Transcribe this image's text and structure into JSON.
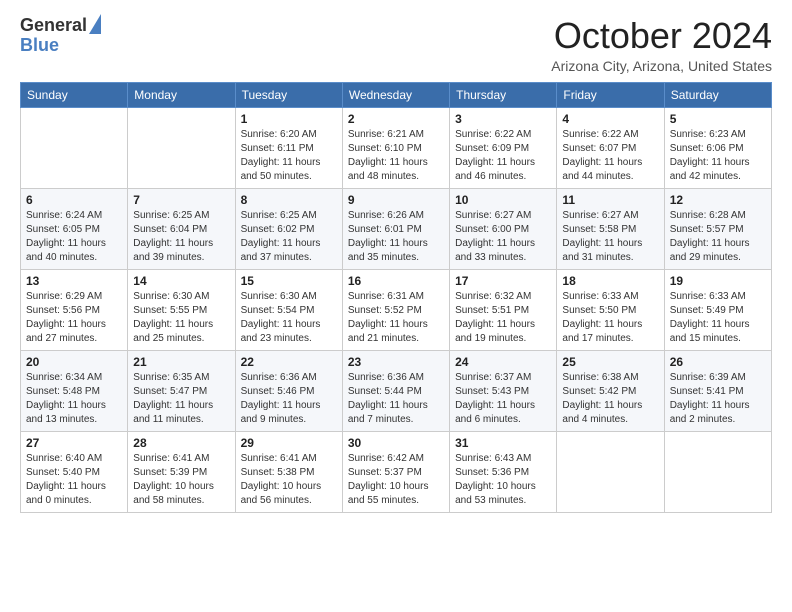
{
  "logo": {
    "line1": "General",
    "line2": "Blue"
  },
  "header": {
    "month": "October 2024",
    "location": "Arizona City, Arizona, United States"
  },
  "days_of_week": [
    "Sunday",
    "Monday",
    "Tuesday",
    "Wednesday",
    "Thursday",
    "Friday",
    "Saturday"
  ],
  "weeks": [
    [
      {
        "day": "",
        "info": ""
      },
      {
        "day": "",
        "info": ""
      },
      {
        "day": "1",
        "info": "Sunrise: 6:20 AM\nSunset: 6:11 PM\nDaylight: 11 hours and 50 minutes."
      },
      {
        "day": "2",
        "info": "Sunrise: 6:21 AM\nSunset: 6:10 PM\nDaylight: 11 hours and 48 minutes."
      },
      {
        "day": "3",
        "info": "Sunrise: 6:22 AM\nSunset: 6:09 PM\nDaylight: 11 hours and 46 minutes."
      },
      {
        "day": "4",
        "info": "Sunrise: 6:22 AM\nSunset: 6:07 PM\nDaylight: 11 hours and 44 minutes."
      },
      {
        "day": "5",
        "info": "Sunrise: 6:23 AM\nSunset: 6:06 PM\nDaylight: 11 hours and 42 minutes."
      }
    ],
    [
      {
        "day": "6",
        "info": "Sunrise: 6:24 AM\nSunset: 6:05 PM\nDaylight: 11 hours and 40 minutes."
      },
      {
        "day": "7",
        "info": "Sunrise: 6:25 AM\nSunset: 6:04 PM\nDaylight: 11 hours and 39 minutes."
      },
      {
        "day": "8",
        "info": "Sunrise: 6:25 AM\nSunset: 6:02 PM\nDaylight: 11 hours and 37 minutes."
      },
      {
        "day": "9",
        "info": "Sunrise: 6:26 AM\nSunset: 6:01 PM\nDaylight: 11 hours and 35 minutes."
      },
      {
        "day": "10",
        "info": "Sunrise: 6:27 AM\nSunset: 6:00 PM\nDaylight: 11 hours and 33 minutes."
      },
      {
        "day": "11",
        "info": "Sunrise: 6:27 AM\nSunset: 5:58 PM\nDaylight: 11 hours and 31 minutes."
      },
      {
        "day": "12",
        "info": "Sunrise: 6:28 AM\nSunset: 5:57 PM\nDaylight: 11 hours and 29 minutes."
      }
    ],
    [
      {
        "day": "13",
        "info": "Sunrise: 6:29 AM\nSunset: 5:56 PM\nDaylight: 11 hours and 27 minutes."
      },
      {
        "day": "14",
        "info": "Sunrise: 6:30 AM\nSunset: 5:55 PM\nDaylight: 11 hours and 25 minutes."
      },
      {
        "day": "15",
        "info": "Sunrise: 6:30 AM\nSunset: 5:54 PM\nDaylight: 11 hours and 23 minutes."
      },
      {
        "day": "16",
        "info": "Sunrise: 6:31 AM\nSunset: 5:52 PM\nDaylight: 11 hours and 21 minutes."
      },
      {
        "day": "17",
        "info": "Sunrise: 6:32 AM\nSunset: 5:51 PM\nDaylight: 11 hours and 19 minutes."
      },
      {
        "day": "18",
        "info": "Sunrise: 6:33 AM\nSunset: 5:50 PM\nDaylight: 11 hours and 17 minutes."
      },
      {
        "day": "19",
        "info": "Sunrise: 6:33 AM\nSunset: 5:49 PM\nDaylight: 11 hours and 15 minutes."
      }
    ],
    [
      {
        "day": "20",
        "info": "Sunrise: 6:34 AM\nSunset: 5:48 PM\nDaylight: 11 hours and 13 minutes."
      },
      {
        "day": "21",
        "info": "Sunrise: 6:35 AM\nSunset: 5:47 PM\nDaylight: 11 hours and 11 minutes."
      },
      {
        "day": "22",
        "info": "Sunrise: 6:36 AM\nSunset: 5:46 PM\nDaylight: 11 hours and 9 minutes."
      },
      {
        "day": "23",
        "info": "Sunrise: 6:36 AM\nSunset: 5:44 PM\nDaylight: 11 hours and 7 minutes."
      },
      {
        "day": "24",
        "info": "Sunrise: 6:37 AM\nSunset: 5:43 PM\nDaylight: 11 hours and 6 minutes."
      },
      {
        "day": "25",
        "info": "Sunrise: 6:38 AM\nSunset: 5:42 PM\nDaylight: 11 hours and 4 minutes."
      },
      {
        "day": "26",
        "info": "Sunrise: 6:39 AM\nSunset: 5:41 PM\nDaylight: 11 hours and 2 minutes."
      }
    ],
    [
      {
        "day": "27",
        "info": "Sunrise: 6:40 AM\nSunset: 5:40 PM\nDaylight: 11 hours and 0 minutes."
      },
      {
        "day": "28",
        "info": "Sunrise: 6:41 AM\nSunset: 5:39 PM\nDaylight: 10 hours and 58 minutes."
      },
      {
        "day": "29",
        "info": "Sunrise: 6:41 AM\nSunset: 5:38 PM\nDaylight: 10 hours and 56 minutes."
      },
      {
        "day": "30",
        "info": "Sunrise: 6:42 AM\nSunset: 5:37 PM\nDaylight: 10 hours and 55 minutes."
      },
      {
        "day": "31",
        "info": "Sunrise: 6:43 AM\nSunset: 5:36 PM\nDaylight: 10 hours and 53 minutes."
      },
      {
        "day": "",
        "info": ""
      },
      {
        "day": "",
        "info": ""
      }
    ]
  ]
}
